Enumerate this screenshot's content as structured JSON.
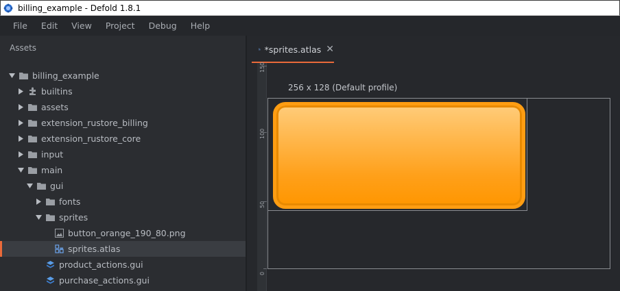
{
  "window": {
    "title": "billing_example - Defold 1.8.1"
  },
  "menu": {
    "items": [
      "File",
      "Edit",
      "View",
      "Project",
      "Debug",
      "Help"
    ]
  },
  "assets": {
    "header": "Assets",
    "tree": [
      {
        "label": "billing_example",
        "icon": "folder-icon",
        "expanded": true,
        "depth": 0
      },
      {
        "label": "builtins",
        "icon": "puzzle-icon",
        "expanded": false,
        "depth": 1
      },
      {
        "label": "assets",
        "icon": "folder-icon",
        "expanded": false,
        "depth": 1
      },
      {
        "label": "extension_rustore_billing",
        "icon": "folder-icon",
        "expanded": false,
        "depth": 1
      },
      {
        "label": "extension_rustore_core",
        "icon": "folder-icon",
        "expanded": false,
        "depth": 1
      },
      {
        "label": "input",
        "icon": "folder-icon",
        "expanded": false,
        "depth": 1
      },
      {
        "label": "main",
        "icon": "folder-icon",
        "expanded": true,
        "depth": 1
      },
      {
        "label": "gui",
        "icon": "folder-icon",
        "expanded": true,
        "depth": 2
      },
      {
        "label": "fonts",
        "icon": "folder-icon",
        "expanded": false,
        "depth": 3
      },
      {
        "label": "sprites",
        "icon": "folder-icon",
        "expanded": true,
        "depth": 3
      },
      {
        "label": "button_orange_190_80.png",
        "icon": "image-file-icon",
        "depth": 4
      },
      {
        "label": "sprites.atlas",
        "icon": "atlas-icon",
        "depth": 4,
        "selected": true
      },
      {
        "label": "product_actions.gui",
        "icon": "gui-file-icon",
        "depth": 3
      },
      {
        "label": "purchase_actions.gui",
        "icon": "gui-file-icon",
        "depth": 3
      }
    ]
  },
  "editor": {
    "tab": {
      "label": "*sprites.atlas",
      "close": "✕",
      "icon": "atlas-icon"
    },
    "profile_label": "256 x 128 (Default profile)",
    "ruler": {
      "ticks": [
        "150",
        "100",
        "50",
        "0"
      ]
    }
  },
  "colors": {
    "accent": "#ea6a3a",
    "selected_bg": "#3a3d42"
  }
}
